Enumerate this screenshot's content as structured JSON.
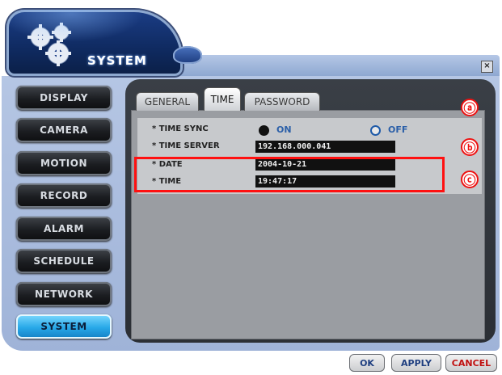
{
  "header": {
    "title": "SYSTEM",
    "close_glyph": "×"
  },
  "sidebar": {
    "items": [
      {
        "label": "DISPLAY",
        "active": false
      },
      {
        "label": "CAMERA",
        "active": false
      },
      {
        "label": "MOTION",
        "active": false
      },
      {
        "label": "RECORD",
        "active": false
      },
      {
        "label": "ALARM",
        "active": false
      },
      {
        "label": "SCHEDULE",
        "active": false
      },
      {
        "label": "NETWORK",
        "active": false
      },
      {
        "label": "SYSTEM",
        "active": true
      }
    ]
  },
  "tabs": [
    {
      "label": "GENERAL",
      "active": false
    },
    {
      "label": "TIME",
      "active": true
    },
    {
      "label": "PASSWORD",
      "active": false
    }
  ],
  "time": {
    "sync_label": "* TIME SYNC",
    "sync_on": "ON",
    "sync_off": "OFF",
    "sync_selected": "ON",
    "server_label": "* TIME SERVER",
    "server_value": "192.168.000.041",
    "date_label": "* DATE",
    "date_value": "2004-10-21",
    "time_label": "* TIME",
    "time_value": "19:47:17"
  },
  "annotations": {
    "a": "ⓐ",
    "b": "ⓑ",
    "c": "ⓒ"
  },
  "footer": {
    "ok": "OK",
    "apply": "APPLY",
    "cancel": "CANCEL"
  },
  "colors": {
    "accent": "#27a8e8",
    "highlight": "#ff1010",
    "cancel_text": "#c01010",
    "button_text": "#1f3f80"
  }
}
